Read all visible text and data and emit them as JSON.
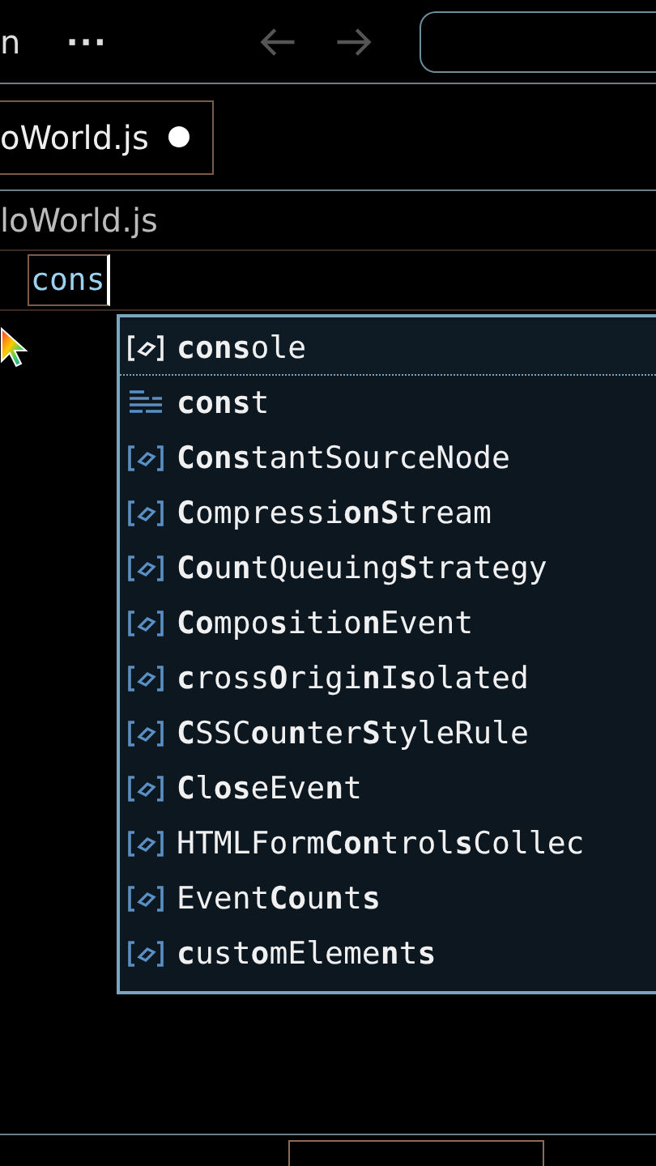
{
  "title_bar": {
    "menu_fragment": "n",
    "more": "···",
    "back_disabled": true,
    "forward_disabled": true
  },
  "tabs": [
    {
      "label": "oWorld.js",
      "modified": true,
      "selected": true
    }
  ],
  "breadcrumb": "loWorld.js",
  "editor": {
    "typed": "cons"
  },
  "suggestions": [
    {
      "kind": "variable",
      "label": "**cons**ole",
      "selected": true
    },
    {
      "kind": "snippet",
      "label": "**cons**t",
      "selected": false
    },
    {
      "kind": "variable",
      "label": "**Cons**tantSourceNode",
      "selected": false
    },
    {
      "kind": "variable",
      "label": "**C**ompressi**onS**tream",
      "selected": false
    },
    {
      "kind": "variable",
      "label": "**Co**u**n**tQueuing**S**trategy",
      "selected": false
    },
    {
      "kind": "variable",
      "label": "**Co**mpo**s**itio**n**Event",
      "selected": false
    },
    {
      "kind": "variable",
      "label": "**c**ross**O**rigi**n**I**s**olated",
      "selected": false
    },
    {
      "kind": "variable",
      "label": "**C**SSC**o**u**n**ter**S**tyleRule",
      "selected": false
    },
    {
      "kind": "variable",
      "label": "**C**l**os**eEve**n**t",
      "selected": false
    },
    {
      "kind": "variable",
      "label": "HTMLForm**Con**trol**s**Collec",
      "selected": false
    },
    {
      "kind": "variable",
      "label": "Event**Co**u**n**t**s**",
      "selected": false
    },
    {
      "kind": "variable",
      "label": "**c**ust**o**mEleme**n**t**s**",
      "selected": false
    }
  ]
}
